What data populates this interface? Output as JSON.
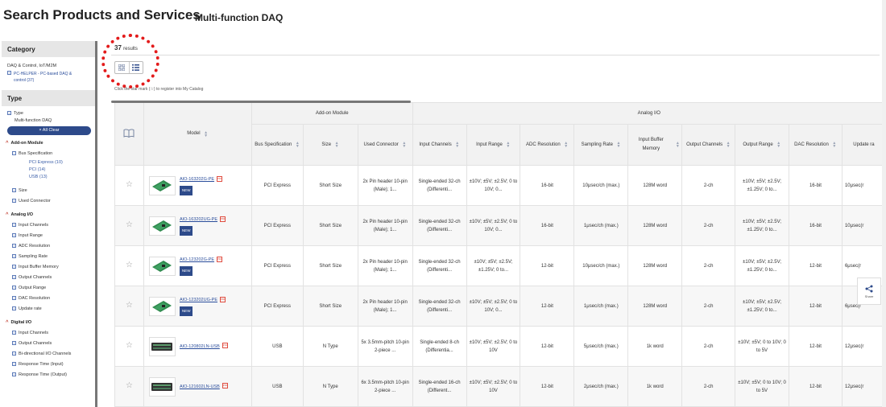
{
  "page": {
    "title": "Search Products and Services",
    "subtitle": "Multi-function DAQ"
  },
  "sidebar": {
    "category_heading": "Category",
    "category_name": "DAQ & Control, IoT/M2M",
    "category_link": "PC-HELPER - PC-based DAQ & control (37)",
    "type_heading": "Type",
    "type_label": "Type",
    "type_value": "Multi-function DAQ",
    "clear_label": "× All Clear",
    "addon_group": "Add-on Module",
    "bus_spec": "Bus Specification",
    "bus_options": [
      "PCI Express (10)",
      "PCI (14)",
      "USB (13)"
    ],
    "addon_items": [
      "Size",
      "Used Connector"
    ],
    "analog_group": "Analog I/O",
    "analog_items": [
      "Input Channels",
      "Input Range",
      "ADC Resolution",
      "Sampling Rate",
      "Input Buffer Memory",
      "Output Channels",
      "Output Range",
      "DAC Resolution",
      "Update rate"
    ],
    "digital_group": "Digital I/O",
    "digital_items": [
      "Input Channels",
      "Output Channels",
      "Bi-directional I/O Channels",
      "Response Time (Input)",
      "Response Time (Output)"
    ]
  },
  "results": {
    "count": "37",
    "suffix": "results"
  },
  "hint": "Click the star mark (☆) to register into My Catalog",
  "table": {
    "group_headers": {
      "addon": "Add-on Module",
      "analog": "Analog I/O"
    },
    "columns": {
      "model": "Model",
      "bus": "Bus Specification",
      "size": "Size",
      "connector": "Used Connector",
      "input_channels": "Input Channels",
      "input_range": "Input Range",
      "adc": "ADC Resolution",
      "sampling": "Sampling Rate",
      "buffer": "Input Buffer Memory",
      "output_channels": "Output Channels",
      "output_range": "Output Range",
      "dac": "DAC Resolution",
      "update": "Update ra"
    },
    "rows": [
      {
        "model": "AIO-163202G-PE",
        "new": "NEW",
        "bus": "PCI Express",
        "size": "Short Size",
        "connector": "2x Pin header 10-pin (Male); 1...",
        "input_channels": "Single-ended 32-ch (Differenti...",
        "input_range": "±10V; ±5V; ±2.5V; 0 to 10V; 0...",
        "adc": "16-bit",
        "sampling": "10μsec/ch (max.)",
        "buffer": "128M word",
        "output_channels": "2-ch",
        "output_range": "±10V; ±5V; ±2.5V; ±1.25V; 0 to...",
        "dac": "16-bit",
        "update": "10μsec(r"
      },
      {
        "model": "AIO-163202UG-PE",
        "new": "NEW",
        "bus": "PCI Express",
        "size": "Short Size",
        "connector": "2x Pin header 10-pin (Male); 1...",
        "input_channels": "Single-ended 32-ch (Differenti...",
        "input_range": "±10V; ±5V; ±2.5V; 0 to 10V; 0...",
        "adc": "16-bit",
        "sampling": "1μsec/ch (max.)",
        "buffer": "128M word",
        "output_channels": "2-ch",
        "output_range": "±10V; ±5V; ±2.5V; ±1.25V; 0 to...",
        "dac": "16-bit",
        "update": "10μsec(r"
      },
      {
        "model": "AIO-123202G-PE",
        "new": "NEW",
        "bus": "PCI Express",
        "size": "Short Size",
        "connector": "2x Pin header 10-pin (Male); 1...",
        "input_channels": "Single-ended 32-ch (Differenti...",
        "input_range": "±10V; ±5V; ±2.5V; ±1.25V; 0 to...",
        "adc": "12-bit",
        "sampling": "10μsec/ch (max.)",
        "buffer": "128M word",
        "output_channels": "2-ch",
        "output_range": "±10V; ±5V; ±2.5V; ±1.25V; 0 to...",
        "dac": "12-bit",
        "update": "6μsec(r"
      },
      {
        "model": "AIO-123202UG-PE",
        "new": "NEW",
        "bus": "PCI Express",
        "size": "Short Size",
        "connector": "2x Pin header 10-pin (Male); 1...",
        "input_channels": "Single-ended 32-ch (Differenti...",
        "input_range": "±10V; ±5V; ±2.5V; 0 to 10V; 0...",
        "adc": "12-bit",
        "sampling": "1μsec/ch (max.)",
        "buffer": "128M word",
        "output_channels": "2-ch",
        "output_range": "±10V; ±5V; ±2.5V; ±1.25V; 0 to...",
        "dac": "12-bit",
        "update": "6μsec(r"
      },
      {
        "model": "AIO-120802LN-USB",
        "new": "",
        "bus": "USB",
        "size": "N Type",
        "connector": "5x 3.5mm-pitch 10-pin 2-piece ...",
        "input_channels": "Single-ended 8-ch (Differentia...",
        "input_range": "±10V; ±5V; ±2.5V; 0 to 10V",
        "adc": "12-bit",
        "sampling": "5μsec/ch (max.)",
        "buffer": "1k word",
        "output_channels": "2-ch",
        "output_range": "±10V; ±5V; 0 to 10V; 0 to 5V",
        "dac": "12-bit",
        "update": "12μsec(r"
      },
      {
        "model": "AIO-121602LN-USB",
        "new": "",
        "bus": "USB",
        "size": "N Type",
        "connector": "6x 3.5mm-pitch 10-pin 2-piece ...",
        "input_channels": "Single-ended 16-ch (Different...",
        "input_range": "±10V; ±5V; ±2.5V; 0 to 10V",
        "adc": "12-bit",
        "sampling": "2μsec/ch (max.)",
        "buffer": "1k word",
        "output_channels": "2-ch",
        "output_range": "±10V; ±5V; 0 to 10V; 0 to 5V",
        "dac": "12-bit",
        "update": "12μsec(r"
      }
    ]
  },
  "share_label": "Share",
  "icons": {
    "catalog": "book-icon",
    "star": "star-icon",
    "pdf": "pdf-icon",
    "share": "share-icon",
    "grid": "grid-view-icon",
    "list": "list-view-icon"
  },
  "colors": {
    "accent": "#2d4a8a",
    "link": "#2a4d9b",
    "annotation": "#e31b1b"
  }
}
